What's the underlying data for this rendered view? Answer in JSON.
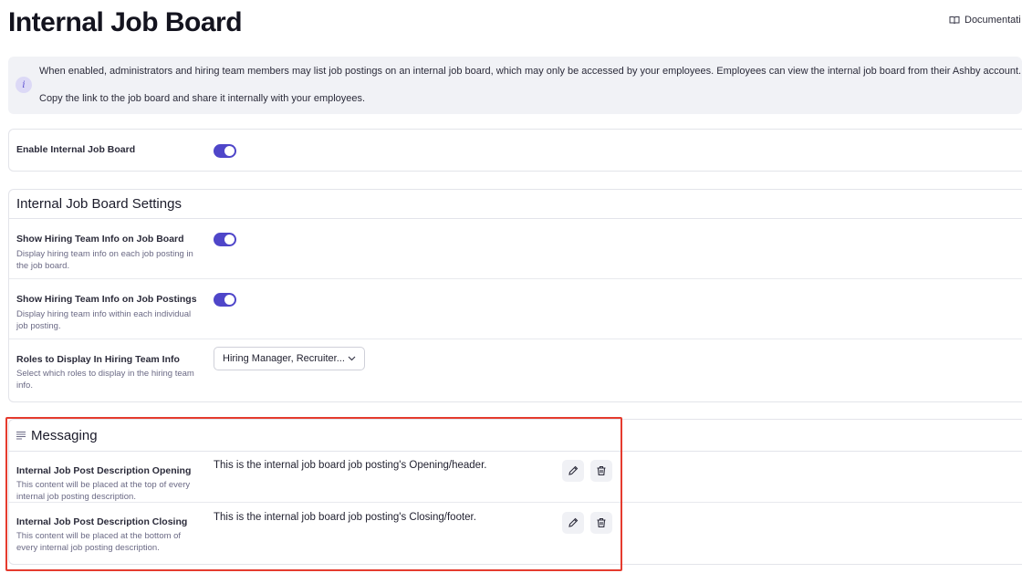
{
  "header": {
    "title": "Internal Job Board",
    "doc_link": "Documentati",
    "doc_icon": "book-icon"
  },
  "info": {
    "icon": "info-icon",
    "icon_glyph": "i",
    "line1": "When enabled, administrators and hiring team members may list job postings on an internal job board, which may only be accessed by your employees. Employees can view the internal job board from their Ashby account.",
    "line2": "Copy the link to the job board and share it internally with your employees."
  },
  "enable": {
    "label": "Enable Internal Job Board",
    "enabled": true
  },
  "settings": {
    "title": "Internal Job Board Settings",
    "rows": [
      {
        "label": "Show Hiring Team Info on Job Board",
        "desc": "Display hiring team info on each job posting in the job board.",
        "enabled": true
      },
      {
        "label": "Show Hiring Team Info on Job Postings",
        "desc": "Display hiring team info within each individual job posting.",
        "enabled": true
      },
      {
        "label": "Roles to Display In Hiring Team Info",
        "desc": "Select which roles to display in the hiring team info.",
        "selected": "Hiring Manager, Recruiter..."
      }
    ]
  },
  "messaging": {
    "title": "Messaging",
    "icon": "lines-icon",
    "rows": [
      {
        "label": "Internal Job Post Description Opening",
        "desc": "This content will be placed at the top of every internal job posting description.",
        "value": "This is the internal job board job posting's Opening/header."
      },
      {
        "label": "Internal Job Post Description Closing",
        "desc": "This content will be placed at the bottom of every internal job posting description.",
        "value": "This is the internal job board job posting's Closing/footer."
      }
    ]
  },
  "colors": {
    "accent": "#4f46c9",
    "highlight": "#e53b2e"
  }
}
